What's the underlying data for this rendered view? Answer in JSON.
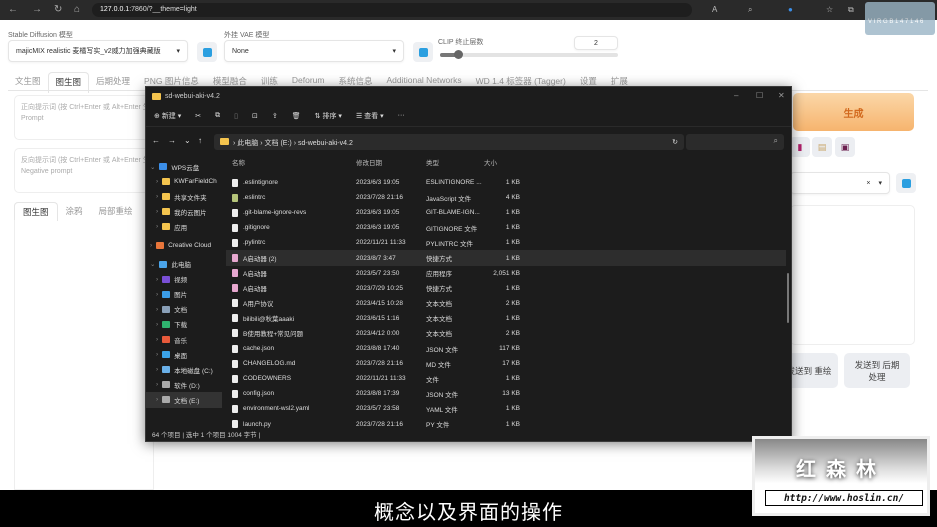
{
  "browser": {
    "url_host": "127.0.0.1",
    "url_rest": ":7860/?__theme=light",
    "profile_text": "V I R G B 1 4 7 1 4 6"
  },
  "sd": {
    "model_label": "Stable Diffusion 模型",
    "model_value": "majicMIX realistic 麦橘写实_v2威力加强典藏版",
    "vae_label": "外挂 VAE 模型",
    "vae_value": "None",
    "clip_label": "CLIP 终止层数",
    "clip_value": "2",
    "clip_fraction": 0.1,
    "tabs": [
      "文生图",
      "图生图",
      "后期处理",
      "PNG 图片信息",
      "模型融合",
      "训练",
      "Deforum",
      "系统信息",
      "Additional Networks",
      "WD 1.4 标签器 (Tagger)",
      "设置",
      "扩展"
    ],
    "active_tab": 1,
    "prompt_placeholder": "正向提示词 (按 Ctrl+Enter 或 Alt+Enter 生成)",
    "prompt_sub": "Prompt",
    "neg_placeholder": "反向提示词 (按 Ctrl+Enter 或 Alt+Enter 生成)",
    "neg_sub": "Negative prompt",
    "subtabs": [
      "图生图",
      "涂鸦",
      "局部重绘"
    ],
    "generate": "生成",
    "clear_x": "×",
    "send_inpaint": "发送到 重绘",
    "send_extras": "发送到 后期处理"
  },
  "explorer": {
    "title": "sd-webui-aki-v4.2",
    "toolbar": {
      "new": "新建",
      "sort": "排序",
      "view": "查看",
      "more": "···"
    },
    "breadcrumb": [
      "此电脑",
      "文档 (E:)",
      "sd-webui-aki-v4.2"
    ],
    "columns": [
      "名称",
      "修改日期",
      "类型",
      "大小"
    ],
    "sidebar": [
      {
        "label": "WPS云盘",
        "color": "#3b8ee8"
      },
      {
        "label": "KWFarFieldCh",
        "color": "#f4c44e"
      },
      {
        "label": "共享文件夹",
        "color": "#f4c44e"
      },
      {
        "label": "我的云图片",
        "color": "#f4c44e"
      },
      {
        "label": "应用",
        "color": "#f4c44e"
      },
      {
        "label": "Creative Cloud",
        "color": "#e8763b"
      },
      {
        "label": "此电脑",
        "color": "#4aa3e8"
      },
      {
        "label": "视频",
        "color": "#7a4fd6"
      },
      {
        "label": "图片",
        "color": "#3b9de8"
      },
      {
        "label": "文档",
        "color": "#8aa0b8"
      },
      {
        "label": "下载",
        "color": "#2fb36e"
      },
      {
        "label": "音乐",
        "color": "#e85a3b"
      },
      {
        "label": "桌面",
        "color": "#3ba3e8"
      },
      {
        "label": "本地磁盘 (C:)",
        "color": "#6ab0e8"
      },
      {
        "label": "软件 (D:)",
        "color": "#aaa"
      },
      {
        "label": "文档 (E:)",
        "color": "#aaa"
      }
    ],
    "files": [
      {
        "name": ".eslintignore",
        "date": "2023/6/3 19:05",
        "type": "ESLINTIGNORE ...",
        "size": "1 KB"
      },
      {
        "name": ".eslintrc",
        "date": "2023/7/28 21:16",
        "type": "JavaScript 文件",
        "size": "4 KB"
      },
      {
        "name": ".git-blame-ignore-revs",
        "date": "2023/6/3 19:05",
        "type": "GIT-BLAME-IGN...",
        "size": "1 KB"
      },
      {
        "name": ".gitignore",
        "date": "2023/6/3 19:05",
        "type": "GITIGNORE 文件",
        "size": "1 KB"
      },
      {
        "name": ".pylintrc",
        "date": "2022/11/21 11:33",
        "type": "PYLINTRC 文件",
        "size": "1 KB"
      },
      {
        "name": "A启动器 (2)",
        "date": "2023/8/7 3:47",
        "type": "快捷方式",
        "size": "1 KB"
      },
      {
        "name": "A启动器",
        "date": "2023/5/7 23:50",
        "type": "应用程序",
        "size": "2,051 KB"
      },
      {
        "name": "A启动器",
        "date": "2023/7/29 10:25",
        "type": "快捷方式",
        "size": "1 KB"
      },
      {
        "name": "A用户协议",
        "date": "2023/4/15 10:28",
        "type": "文本文档",
        "size": "2 KB"
      },
      {
        "name": "bilibili@秋葉aaaki",
        "date": "2023/6/15 1:16",
        "type": "文本文档",
        "size": "1 KB"
      },
      {
        "name": "B使用教程+常见问题",
        "date": "2023/4/12 0:00",
        "type": "文本文档",
        "size": "2 KB"
      },
      {
        "name": "cache.json",
        "date": "2023/8/8 17:40",
        "type": "JSON 文件",
        "size": "117 KB"
      },
      {
        "name": "CHANGELOG.md",
        "date": "2023/7/28 21:16",
        "type": "MD 文件",
        "size": "17 KB"
      },
      {
        "name": "CODEOWNERS",
        "date": "2022/11/21 11:33",
        "type": "文件",
        "size": "1 KB"
      },
      {
        "name": "config.json",
        "date": "2023/8/8 17:39",
        "type": "JSON 文件",
        "size": "13 KB"
      },
      {
        "name": "environment-wsl2.yaml",
        "date": "2023/5/7 23:58",
        "type": "YAML 文件",
        "size": "1 KB"
      },
      {
        "name": "launch.py",
        "date": "2023/7/28 21:16",
        "type": "PY 文件",
        "size": "1 KB"
      }
    ],
    "highlighted_row": 5,
    "status": "64 个项目  |  选中 1 个项目  1004 字节  |"
  },
  "subtitle": "概念以及界面的操作",
  "watermark": {
    "title": "红森林",
    "url": "http://www.hoslin.cn/"
  }
}
